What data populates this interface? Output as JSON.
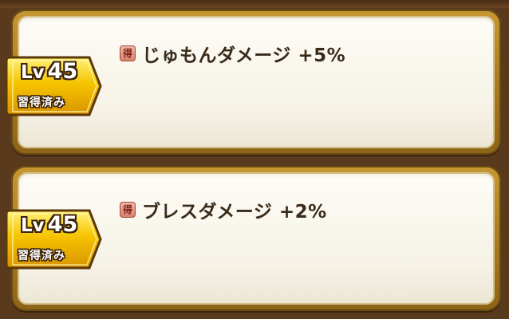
{
  "skills": [
    {
      "badge": "得",
      "text": "じゅもんダメージ +5%",
      "level_word": "Lv",
      "level_value": "45",
      "status": "習得済み"
    },
    {
      "badge": "得",
      "text": "ブレスダメージ +2%",
      "level_word": "Lv",
      "level_value": "45",
      "status": "習得済み"
    }
  ],
  "colors": {
    "frame_gold": "#b8892a",
    "panel_cream": "#f8f5ea",
    "badge_red": "#d9806f",
    "tag_gold": "#f2c200",
    "text_dark": "#3a2a1a"
  },
  "icons": [
    "toku-badge-icon",
    "level-tag-ribbon"
  ]
}
